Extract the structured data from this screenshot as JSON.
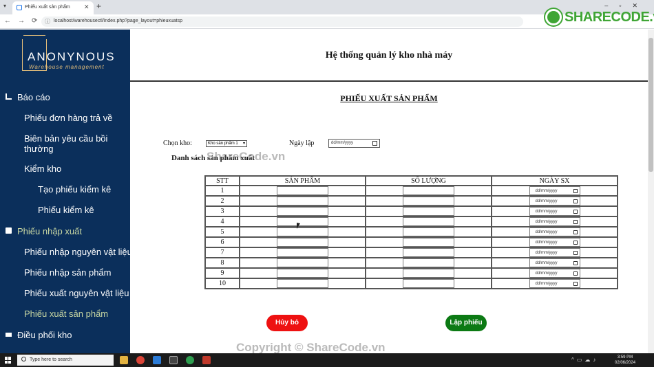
{
  "browser": {
    "tab_title": "Phiếu xuất sản phẩm",
    "url": "localhost/warehousectl/index.php?page_layout=phieuxuatsp",
    "watermark_logo": "SHARECODE.vn"
  },
  "sidebar": {
    "brand_name": "ANONYNOUS",
    "brand_sub": "Warehouse management",
    "items": [
      {
        "label": "Báo cáo"
      },
      {
        "label": "Phiếu đơn hàng trả về"
      },
      {
        "label": "Biên bản yêu cầu bồi thường"
      },
      {
        "label": "Kiểm kho"
      },
      {
        "label": "Tạo phiếu kiểm kê"
      },
      {
        "label": "Phiếu kiểm kê"
      },
      {
        "label": "Phiếu nhập xuất"
      },
      {
        "label": "Phiếu nhập nguyên vật liệu"
      },
      {
        "label": "Phiếu nhập sản phẩm"
      },
      {
        "label": "Phiếu xuất nguyên vật liệu"
      },
      {
        "label": "Phiếu xuất sản phẩm"
      },
      {
        "label": "Điều phối kho"
      }
    ]
  },
  "main": {
    "system_title": "Hệ thống quản lý kho nhà máy",
    "form_title": "PHIẾU XUẤT SẢN PHẨM",
    "warehouse_label": "Chọn kho:",
    "warehouse_value": "Kho sản phẩm 1",
    "date_label": "Ngày lập",
    "date_placeholder": "dd/mm/yyyy",
    "list_title": "Danh sách sản phẩm xuất",
    "table": {
      "headers": [
        "STT",
        "SẢN PHẨM",
        "SỐ LƯỢNG",
        "NGÀY SX"
      ],
      "rows": [
        "1",
        "2",
        "3",
        "4",
        "5",
        "6",
        "7",
        "8",
        "9",
        "10"
      ],
      "date_placeholder": "dd/mm/yyyy"
    },
    "cancel_label": "Hủy bỏ",
    "create_label": "Lập phiếu"
  },
  "watermark": {
    "center": "ShareCode.vn",
    "bottom": "Copyright © ShareCode.vn"
  },
  "taskbar": {
    "search_placeholder": "Type here to search",
    "time": "3:59 PM",
    "date": "02/06/2024"
  },
  "colors": {
    "sidebar_bg": "#0b2f5b",
    "cancel": "#ee1111",
    "create": "#0c7a14",
    "active_nav": "#c8d7a3"
  }
}
